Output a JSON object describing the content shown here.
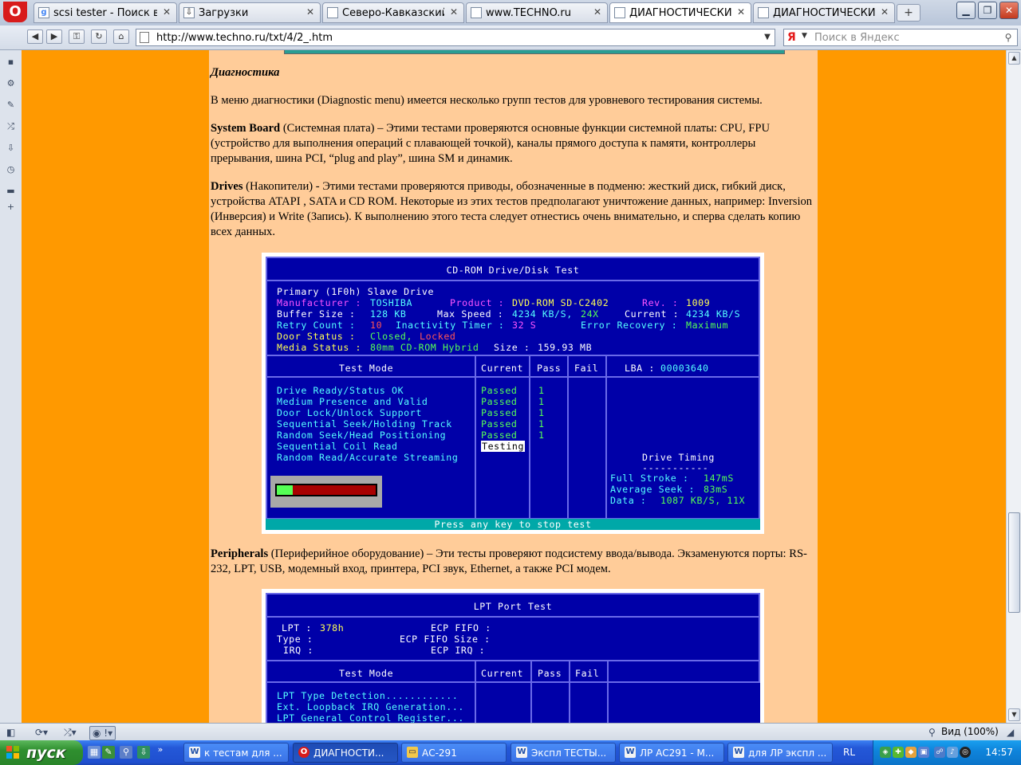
{
  "browser": {
    "tabs": [
      {
        "title": "scsi tester - Поиск в...",
        "icon": "google-icon",
        "active": false
      },
      {
        "title": "Загрузки",
        "icon": "downloads-icon",
        "active": false
      },
      {
        "title": "Северо-Кавказский ...",
        "icon": "page-icon",
        "active": false
      },
      {
        "title": "www.TECHNO.ru",
        "icon": "page-icon",
        "active": false
      },
      {
        "title": "ДИАГНОСТИЧЕСКИЕ...",
        "icon": "page-icon",
        "active": true
      },
      {
        "title": "ДИАГНОСТИЧЕСКИЕ...",
        "icon": "page-icon",
        "active": false
      }
    ],
    "new_tab_label": "+",
    "address": "http://www.techno.ru/txt/4/2_.htm",
    "search": {
      "engine_logo": "Я",
      "placeholder": "Поиск в Яндекс"
    },
    "zoom_label": "Вид (100%)"
  },
  "article": {
    "section_title": "Диагностика",
    "intro": "В меню диагностики (Diagnostic menu) имеется несколько групп тестов для уровневого тестирования системы.",
    "system_board_term": "System Board",
    "system_board_text": " (Системная плата) – Этими тестами проверяются основные функции системной платы: CPU, FPU (устройство для выполнения операций с плавающей точкой), каналы прямого доступа к памяти, контроллеры прерывания, шина PCI, “plug and play”, шина SM и динамик.",
    "drives_term": "Drives",
    "drives_text": " (Накопители) - Этими тестами проверяются приводы, обозначенные в подменю: жесткий диск, гибкий диск, устройства ATAPI , SATA и CD ROM. Некоторые из этих тестов предполагают уничтожение данных, например: Inversion (Инверсия) и Write (Запись). К выполнению этого теста следует отнестись очень внимательно, и сперва сделать копию всех данных.",
    "peripherals_term": "Peripherals",
    "peripherals_text": " (Периферийное оборудование) – Эти тесты проверяют подсистему ввода/вывода. Экзаменуются порты: RS-232, LPT, USB, модемный вход, принтера, PCI звук, Ethernet, а также PCI модем."
  },
  "cdrom_screen": {
    "title": "CD-ROM Drive/Disk Test",
    "drive": "Primary (1F0h) Slave Drive",
    "manufacturer_label": "Manufacturer :",
    "manufacturer": "TOSHIBA",
    "product_label": "Product :",
    "product": "DVD-ROM SD-C2402",
    "rev_label": "Rev. :",
    "rev": "1009",
    "buffer_label": "Buffer Size :",
    "buffer": "128 KB",
    "max_speed_label": "Max Speed :",
    "max_speed": "4234 KB/S,",
    "max_speed_x": "24X",
    "current_label": "Current :",
    "current": "4234 KB/S",
    "retry_label": "Retry Count :",
    "retry": "10",
    "inactivity_label": "Inactivity Timer :",
    "inactivity": "32 S",
    "error_label": "Error Recovery :",
    "error": "Maximum",
    "door_label": "Door Status :",
    "door_closed": "Closed,",
    "door_locked": "Locked",
    "media_label": "Media Status :",
    "media": "80mm CD-ROM Hybrid",
    "size_label": "Size :",
    "size": "159.93 MB",
    "col_test_mode": "Test Mode",
    "col_current": "Current",
    "col_pass": "Pass",
    "col_fail": "Fail",
    "lba_label": "LBA :",
    "lba": "00003640",
    "tests": [
      {
        "name": "Drive Ready/Status OK",
        "current": "Passed",
        "pass": "1"
      },
      {
        "name": "Medium Presence and Valid",
        "current": "Passed",
        "pass": "1"
      },
      {
        "name": "Door Lock/Unlock Support",
        "current": "Passed",
        "pass": "1"
      },
      {
        "name": "Sequential Seek/Holding Track",
        "current": "Passed",
        "pass": "1"
      },
      {
        "name": "Random Seek/Head Positioning",
        "current": "Passed",
        "pass": "1"
      },
      {
        "name": "Sequential Coil Read",
        "current": "Testing",
        "pass": ""
      },
      {
        "name": "Random Read/Accurate Streaming",
        "current": "",
        "pass": ""
      }
    ],
    "progress_fraction": 0.16,
    "timing_title": "Drive Timing",
    "timing_rule": "-----------",
    "full_stroke_label": "Full Stroke :",
    "full_stroke": "147mS",
    "avg_seek_label": "Average Seek :",
    "avg_seek": "83mS",
    "data_label": "Data :",
    "data": "1087 KB/S, 11X",
    "status_bar": "Press any key to stop test"
  },
  "lpt_screen": {
    "title": "LPT Port Test",
    "lpt_label": "LPT :",
    "lpt": "378h",
    "type_label": "Type :",
    "irq_label": "IRQ :",
    "ecp_fifo_label": "ECP FIFO :",
    "ecp_fifo_size_label": "ECP FIFO Size :",
    "ecp_irq_label": "ECP IRQ :",
    "col_test_mode": "Test Mode",
    "col_current": "Current",
    "col_pass": "Pass",
    "col_fail": "Fail",
    "tests": [
      "LPT Type Detection............",
      "Ext. Loopback IRQ Generation...",
      "LPT General Control Register..."
    ]
  },
  "taskbar": {
    "start_label": "пуск",
    "tasks": [
      {
        "title": "к тестам для ...",
        "icon": "word-icon",
        "active": false
      },
      {
        "title": "ДИАГНОСТИ...",
        "icon": "opera-icon",
        "active": true
      },
      {
        "title": "АС-291",
        "icon": "folder-icon",
        "active": false
      },
      {
        "title": "Экспл ТЕСТЫ...",
        "icon": "word-icon",
        "active": false
      },
      {
        "title": "ЛР АС291 - М...",
        "icon": "word-icon",
        "active": false
      },
      {
        "title": "для ЛР экспл ...",
        "icon": "word-icon",
        "active": false
      }
    ],
    "language": "RL",
    "clock": "14:57"
  },
  "colors": {
    "page_bg": "#ff9900",
    "column_bg": "#ffcc99",
    "dos_bg": "#0000a8",
    "dos_border": "#6a6ae8",
    "status_cyan": "#00a8a8",
    "taskbar": "#245edb",
    "start_green": "#3c9a3c"
  }
}
